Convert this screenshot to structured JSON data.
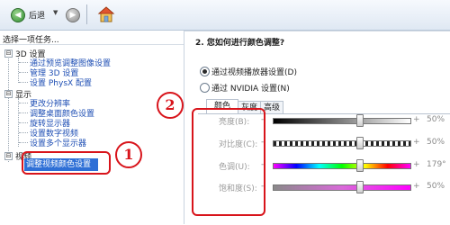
{
  "toolbar": {
    "back_label": "后退",
    "back_dropdown": "▼",
    "back_icon": "back-arrow-icon",
    "forward_icon": "forward-arrow-icon",
    "home_icon": "home-icon"
  },
  "sidebar": {
    "task_header": "选择一项任务...",
    "categories": [
      {
        "toggle": "⊟",
        "label": "3D 设置",
        "items": [
          "通过预览调整图像设置",
          "管理 3D 设置",
          "设置 PhysX 配置"
        ]
      },
      {
        "toggle": "⊟",
        "label": "显示",
        "items": [
          "更改分辨率",
          "调整桌面颜色设置",
          "旋转显示器",
          "设置数字视频",
          "设置多个显示器"
        ]
      },
      {
        "toggle": "⊟",
        "label": "视频",
        "items": [
          "调整视频颜色设置"
        ]
      }
    ]
  },
  "main": {
    "section_title": "2. 您如何进行颜色调整?",
    "options": [
      {
        "label": "通过视频播放器设置(D)",
        "selected": true
      },
      {
        "label": "通过 NVIDIA 设置(N)",
        "selected": false
      }
    ],
    "tabs": [
      {
        "label": "颜色",
        "active": true
      },
      {
        "label": "灰度",
        "active": false
      },
      {
        "label": "高级",
        "active": false
      }
    ],
    "sliders": [
      {
        "label": "亮度(B):",
        "minus": "-",
        "plus": "+",
        "value": "50%",
        "level": 0.5
      },
      {
        "label": "对比度(C):",
        "minus": "-",
        "plus": "+",
        "value": "50%",
        "level": 0.5
      },
      {
        "label": "色调(U):",
        "minus": "-",
        "plus": "+",
        "value": "179°",
        "level": 0.5
      },
      {
        "label": "饱和度(S):",
        "minus": "-",
        "plus": "+",
        "value": "50%",
        "level": 0.5
      }
    ]
  },
  "annotations": {
    "marker_1": "1",
    "marker_2": "2",
    "color": "#d8141b"
  }
}
